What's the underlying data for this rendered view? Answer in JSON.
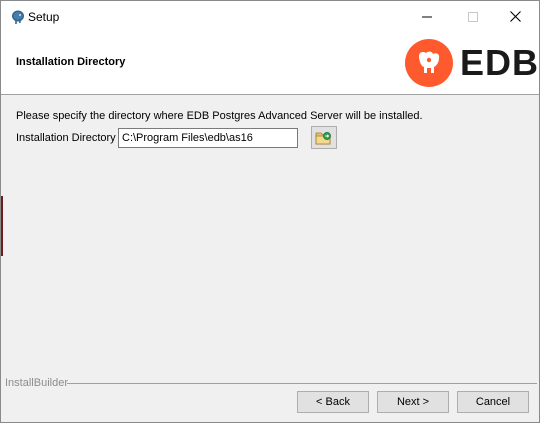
{
  "window": {
    "title": "Setup"
  },
  "titlebar": {
    "icon": "postgres-elephant-icon",
    "minimize_icon": "minimize-icon",
    "maximize_icon": "maximize-icon",
    "close_icon": "close-icon"
  },
  "header": {
    "title": "Installation Directory",
    "logo_text": "EDB",
    "logo_color": "#ff5a2e"
  },
  "content": {
    "instruction": "Please specify the directory where EDB Postgres Advanced Server will be installed.",
    "dir_label": "Installation Directory",
    "dir_value": "C:\\Program Files\\edb\\as16",
    "browse_icon": "folder-browse-icon"
  },
  "footer": {
    "brand": "InstallBuilder",
    "back_label": "< Back",
    "next_label": "Next >",
    "cancel_label": "Cancel"
  }
}
